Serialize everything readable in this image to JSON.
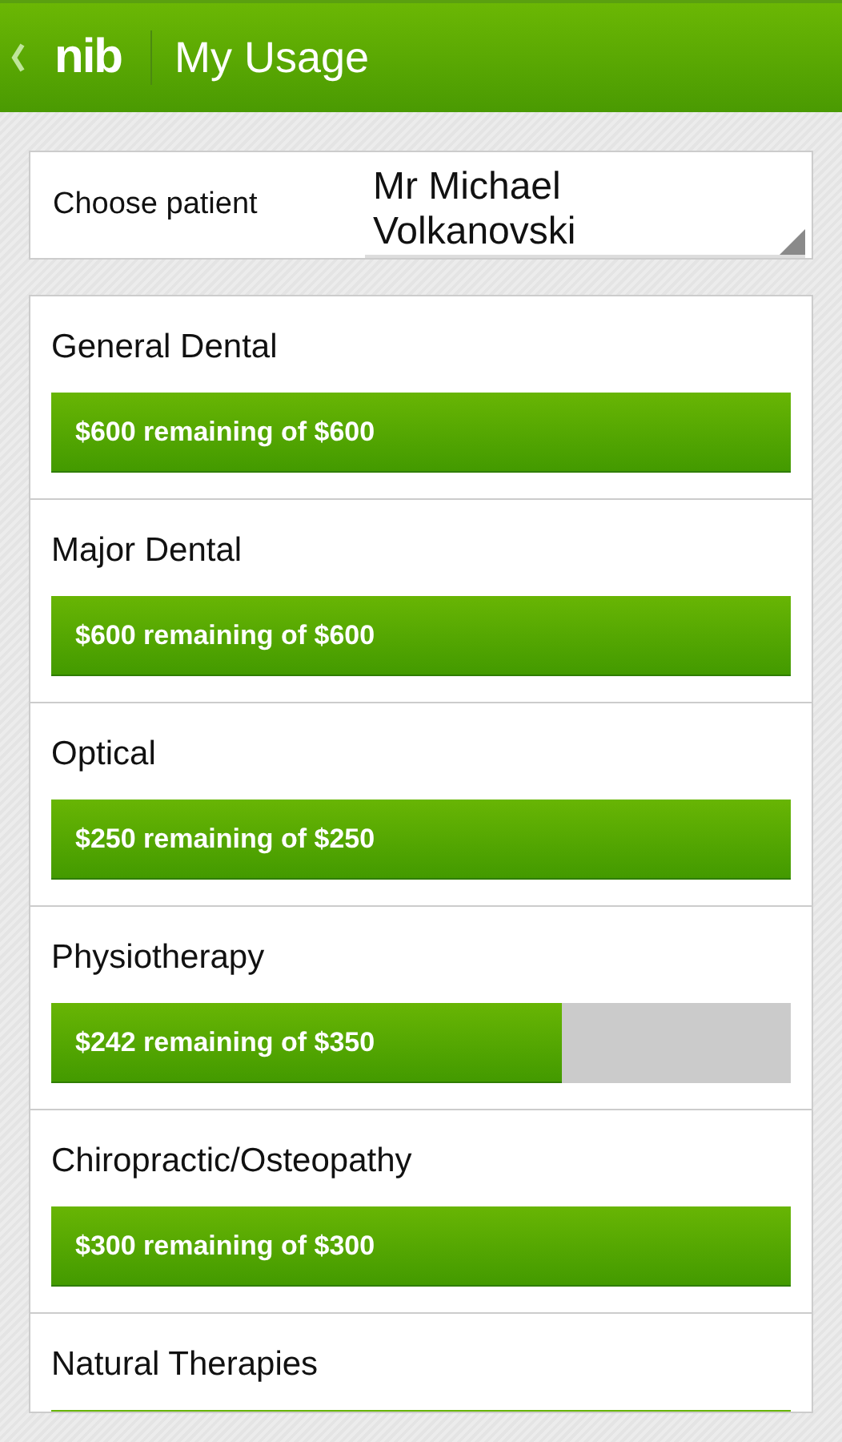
{
  "header": {
    "logo": "nib",
    "title": "My Usage"
  },
  "patient": {
    "label": "Choose patient",
    "value": "Mr Michael Volkanovski"
  },
  "benefits": [
    {
      "name": "General Dental",
      "level": 1,
      "reading": "$600 remaining of $600"
    },
    {
      "name": "Major Dental",
      "level": 1,
      "reading": "$600 remaining of $600"
    },
    {
      "name": "Optical",
      "level": 1,
      "reading": "$250 remaining of $250"
    },
    {
      "name": "Physiotherapy",
      "level": 0.69,
      "reading": "$242 remaining of $350"
    },
    {
      "name": "Chiropractic/Osteopathy",
      "level": 1,
      "reading": "$300 remaining of $300"
    },
    {
      "name": "Natural Therapies",
      "level": 1
    }
  ]
}
